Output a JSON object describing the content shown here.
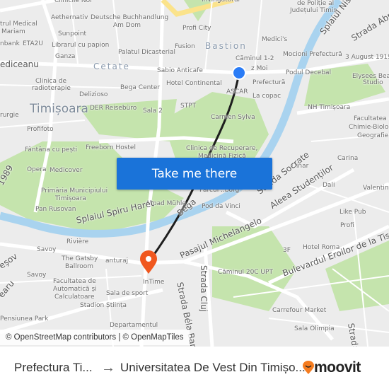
{
  "map": {
    "labels": [
      "Clinicile Noi",
      "Aethernativ",
      "Deutsche Buchhandlung",
      "Am Dom",
      "trul Medical",
      "Mariam",
      "Sunpoint",
      "Librarul cu papion",
      "nbank",
      "ETA2U",
      "Ganza",
      "Palatul Dicasterial",
      "Fusion",
      "Profi City",
      "Invingatorul",
      "ediceanu",
      "Cetate",
      "Sabio Anticafe",
      "Bastion",
      "Căminul 1-2",
      "Medici's",
      "Mocioni Prefectură",
      "3 August 1919",
      "de Poliție al",
      "Județului Timiș",
      "Splaiul Nistrului",
      "Strada Abr",
      "z Moi",
      "Podul Decebal",
      "Elysees Beauty",
      "Studio",
      "Hotel Continental",
      "Prefectură",
      "ASCAR",
      "La copac",
      "Clinica de",
      "radioterapie",
      "Bega Center",
      "Delizioso",
      "Timișoara",
      "DER Reisebüro",
      "Sala 2",
      "STPT",
      "NH Timișoara",
      "Carmen Sylva",
      "Facultatea de",
      "Chimie-Biologie-",
      "Geografie",
      "rurgie",
      "Profifoto",
      "Fântâna cu pești",
      "Freeborn Hostel",
      "Clinica de Recuperare,",
      "Medicină Fizică",
      "Carina",
      "Dinar",
      "Opera",
      "Medicover",
      "Primăria Municipiului",
      "Timișoara",
      "Dali",
      "Valentina",
      "Parcul ..borg",
      "Arpad Mühle",
      "Pod da Vinci",
      "Bega",
      "Splaiul Spiru Haret",
      "Pan Rusovan",
      "Strada Socrate",
      "Aleea Studenților",
      "Like Pub",
      "Profi",
      "Pasajul Michelangelo",
      "Rivière",
      "Savoy",
      "The Gatsby",
      "Ballroom",
      "anturaj",
      "3F",
      "Hotel Roma",
      "Savoy",
      "Facultatea de",
      "Automatică și",
      "Calculatoare",
      "InTime",
      "Sala de sport",
      "Stadion Știința",
      "Căminul 20C UPT",
      "Bulevardul Eroilor de la Tisa",
      "Strada Cluj",
      "Strada Béla Bartók",
      "Carrefour Market",
      "Sala Olimpia",
      "Pensiunea Park",
      "Departamentul",
      "eşov",
      "earu",
      "1989",
      "Strada"
    ],
    "colors": {
      "background": "#ececec",
      "park": "#c5e4ad",
      "water": "#a9d3ef",
      "route": "#1e1e1e",
      "origin": "#2a7cf6",
      "destination": "#f0571e"
    }
  },
  "cta": {
    "label": "Take me there"
  },
  "attribution": "© OpenStreetMap contributors | © OpenMapTiles",
  "footer": {
    "from": "Prefectura Ti...",
    "arrow": "→",
    "to": "Universitatea De Vest Din Timișo...",
    "logo": "moovit"
  }
}
